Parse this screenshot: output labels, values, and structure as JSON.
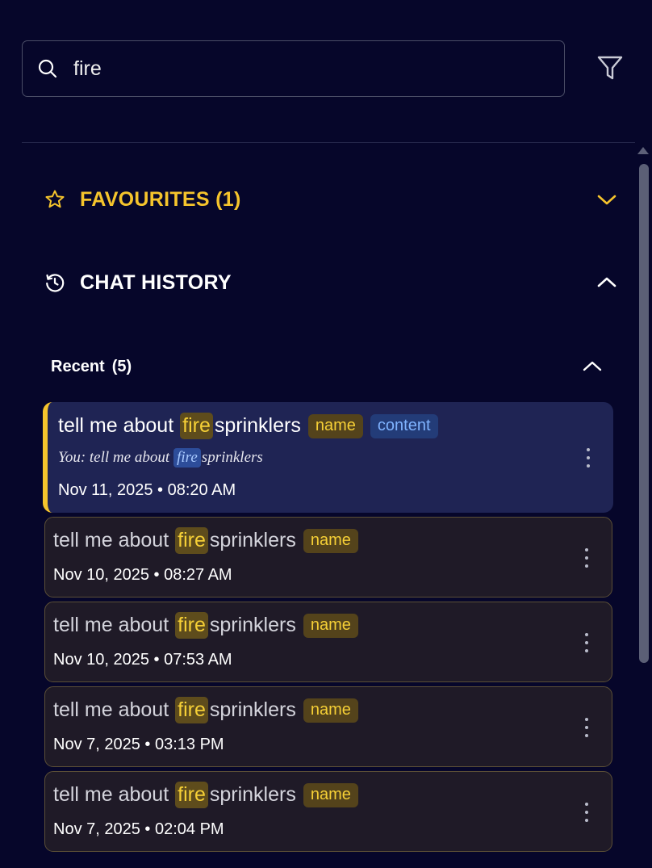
{
  "search": {
    "value": "fire",
    "placeholder": ""
  },
  "favourites": {
    "label": "FAVOURITES (1)"
  },
  "history": {
    "label": "CHAT HISTORY"
  },
  "recent": {
    "label": "Recent",
    "count": "(5)"
  },
  "tags": {
    "name": "name",
    "content": "content"
  },
  "chats": [
    {
      "pre": "tell me about",
      "match": "fire",
      "post": "sprinklers",
      "preview_pre": "You: tell me about",
      "preview_match": "fire",
      "preview_post": "sprinklers",
      "date": "Nov 11, 2025 • 08:20 AM"
    },
    {
      "pre": "tell me about",
      "match": "fire",
      "post": "sprinklers",
      "date": "Nov 10, 2025 • 08:27 AM"
    },
    {
      "pre": "tell me about",
      "match": "fire",
      "post": "sprinklers",
      "date": "Nov 10, 2025 • 07:53 AM"
    },
    {
      "pre": "tell me about",
      "match": "fire",
      "post": "sprinklers",
      "date": "Nov 7, 2025 • 03:13 PM"
    },
    {
      "pre": "tell me about",
      "match": "fire",
      "post": "sprinklers",
      "date": "Nov 7, 2025 • 02:04 PM"
    }
  ],
  "colors": {
    "background": "#06062a",
    "accent": "#f5c42c",
    "active_card": "#1f2454",
    "card": "#1f1a27",
    "highlight": "#5e4c1c",
    "content_tag": "#233c78"
  }
}
